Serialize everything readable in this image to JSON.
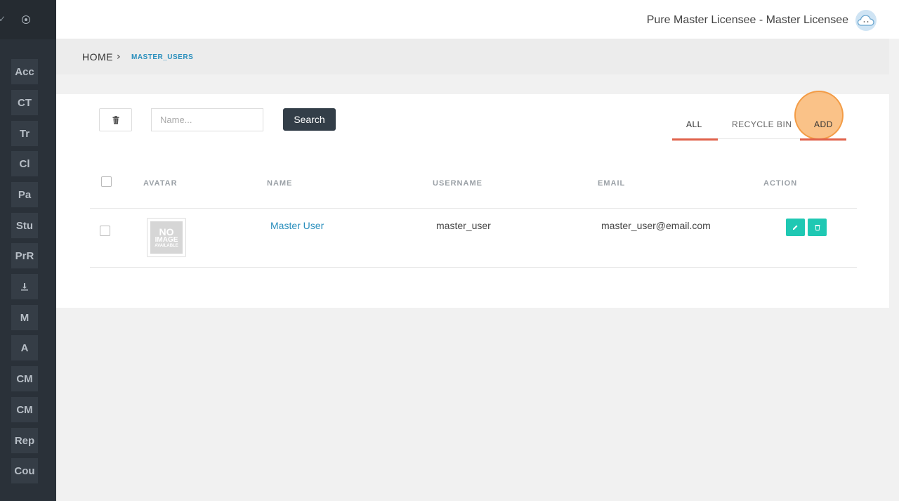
{
  "sidebar": {
    "items": [
      {
        "label": "Acc"
      },
      {
        "label": "CT"
      },
      {
        "label": "Tr"
      },
      {
        "label": "Cl"
      },
      {
        "label": "Pa"
      },
      {
        "label": "Stu"
      },
      {
        "label": "PrR"
      },
      {
        "label": "",
        "icon": "download-icon"
      },
      {
        "label": "M"
      },
      {
        "label": "A"
      },
      {
        "label": "CM"
      },
      {
        "label": "CM"
      },
      {
        "label": "Rep"
      },
      {
        "label": "Cou"
      }
    ]
  },
  "header": {
    "user_name": "Pure Master Licensee - Master Licensee",
    "avatar_icon": "cloud-avatar-icon"
  },
  "breadcrumb": {
    "home": "HOME",
    "separator": "›",
    "current": "MASTER_USERS"
  },
  "toolbar": {
    "delete_icon": "trash-icon",
    "search_placeholder": "Name...",
    "search_label": "Search"
  },
  "tabs": {
    "all": "ALL",
    "recycle_bin": "RECYCLE BIN",
    "add": "ADD",
    "active": "all"
  },
  "table": {
    "columns": [
      "AVATAR",
      "NAME",
      "USERNAME",
      "EMAIL",
      "ACTION"
    ],
    "rows": [
      {
        "avatar": {
          "line1": "NO",
          "line2": "IMAGE",
          "line3": "AVAILABLE"
        },
        "name": "Master User",
        "username": "master_user",
        "email": "master_user@email.com",
        "actions": [
          "edit-icon",
          "trash-icon"
        ]
      }
    ]
  },
  "colors": {
    "sidebar_bg": "#2a3139",
    "accent_link": "#2a8fbd",
    "tab_underline": "#e0614a",
    "action_button": "#1fc8b3",
    "search_button": "#333e48"
  }
}
